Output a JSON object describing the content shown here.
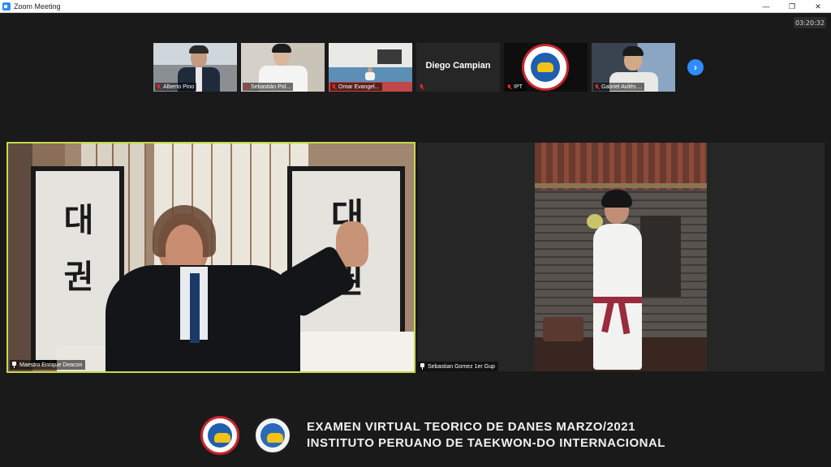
{
  "window": {
    "title": "Zoom Meeting"
  },
  "timer": "03:20:32",
  "thumbnails": [
    {
      "name": "Alberto Pino"
    },
    {
      "name": "Sebastián Pol..."
    },
    {
      "name": "Omar Evangel..."
    },
    {
      "name": "",
      "display_name": "Diego Campian"
    },
    {
      "name": "IPT"
    },
    {
      "name": "Gabriel Avilés ..."
    }
  ],
  "main_tiles": {
    "speaker": {
      "name": "Maestro Enrique Deacon"
    },
    "participant": {
      "name": "Sebastian Gomez 1er Gup"
    }
  },
  "calligraphy": {
    "left": "대 권",
    "right": "대 권"
  },
  "logos": {
    "ipt_text": "CH",
    "itf_text": "CH"
  },
  "footer": {
    "line1": "EXAMEN VIRTUAL TEORICO DE DANES MARZO/2021",
    "line2": "INSTITUTO PERUANO DE TAEKWON-DO INTERNACIONAL"
  },
  "colors": {
    "active_speaker_border": "#c7d94a",
    "accent": "#2d8cff",
    "mic_off": "#e02828"
  }
}
